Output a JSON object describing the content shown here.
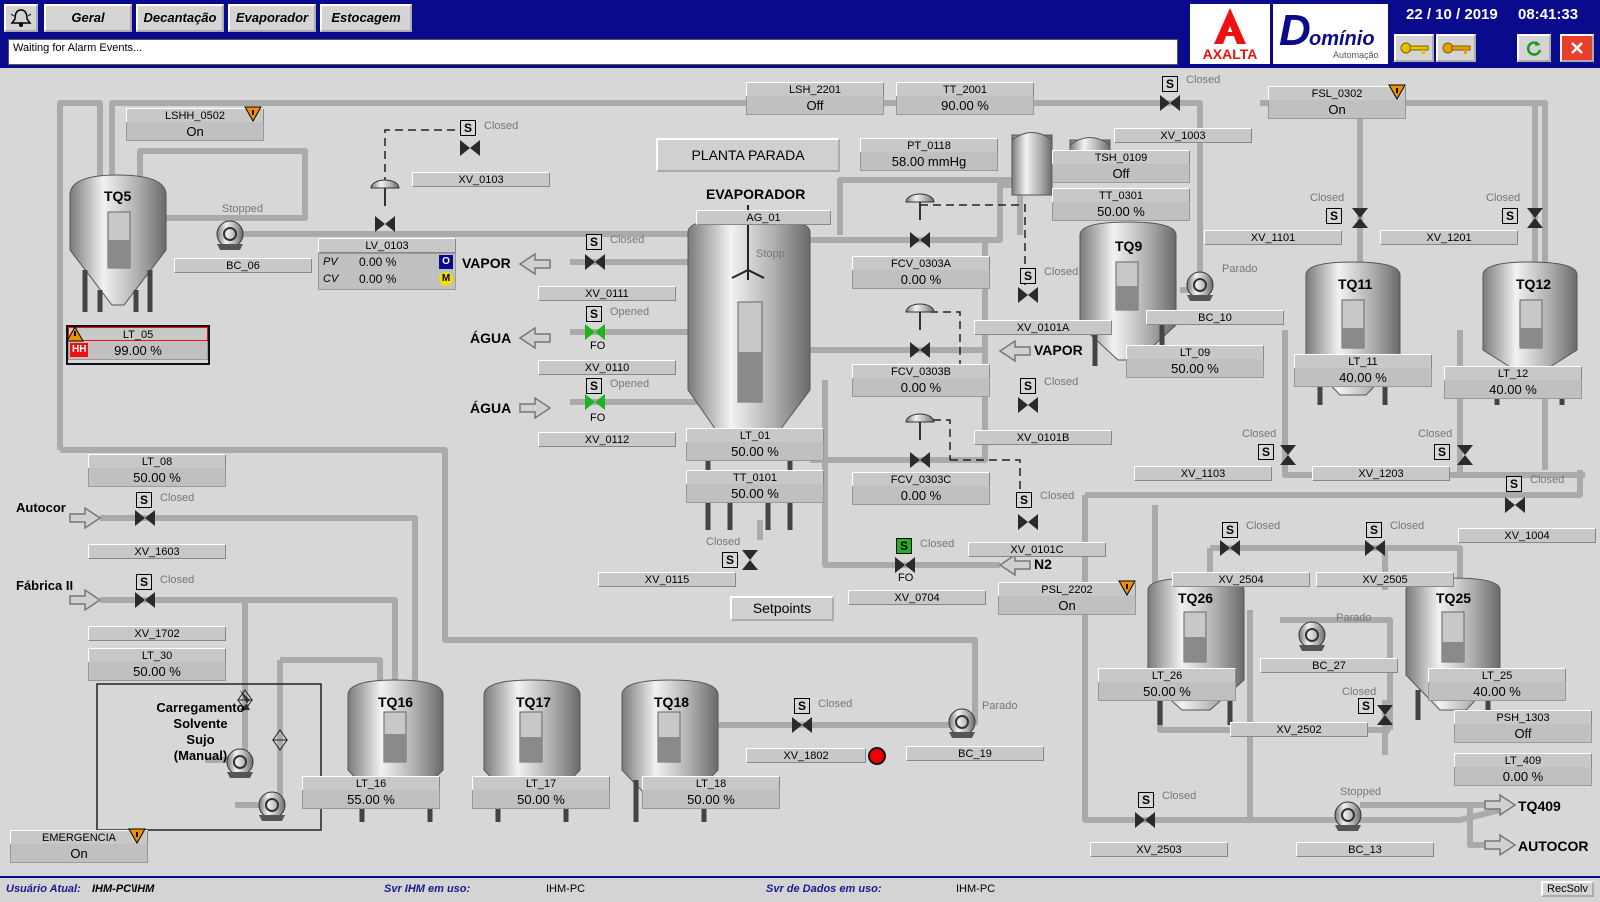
{
  "tabs": [
    "Geral",
    "Decantação",
    "Evaporador",
    "Estocagem"
  ],
  "alarm_text": "Waiting for Alarm Events...",
  "date": "22 / 10 / 2019",
  "time": "08:41:33",
  "logos": {
    "axalta": "AXALTA",
    "dominio": "omínio",
    "dominio_D": "D",
    "dominio_sub": "Automação"
  },
  "status": {
    "user_label": "Usuário Atual:",
    "user_value": "IHM-PC\\IHM",
    "ihm_label": "Svr IHM em uso:",
    "ihm_value": "IHM-PC",
    "dados_label": "Svr de Dados em uso:",
    "dados_value": "IHM-PC",
    "recsolv": "RecSolv"
  },
  "tanks": {
    "tq5": "TQ5",
    "tq9": "TQ9",
    "tq11": "TQ11",
    "tq12": "TQ12",
    "tq26": "TQ26",
    "tq25": "TQ25",
    "tq16": "TQ16",
    "tq17": "TQ17",
    "tq18": "TQ18"
  },
  "tank_levels": {
    "tq5": 0.5,
    "tq9": 0.5,
    "tq11": 0.4,
    "tq12": 0.4,
    "tq26": 0.5,
    "tq25": 0.4,
    "tq16": 0.55,
    "tq17": 0.5,
    "tq18": 0.5,
    "evap": 0.5
  },
  "evaporador": {
    "title": "EVAPORADOR",
    "ag": "AG_01",
    "ag_state": "Stopp"
  },
  "planta": "PLANTA PARADA",
  "setpoints": "Setpoints",
  "carregamento": [
    "Carregamento",
    "Solvente",
    "Sujo",
    "(Manual)"
  ],
  "labels": {
    "vapor1": "VAPOR",
    "agua1": "ÁGUA",
    "agua2": "ÁGUA",
    "vapor2": "VAPOR",
    "n2": "N2",
    "autocor_in": "Autocor",
    "fabrica": "Fábrica II",
    "tq409": "TQ409",
    "autocor_out": "AUTOCOR"
  },
  "tags": {
    "lsh2201": {
      "n": "LSH_2201",
      "v": "Off"
    },
    "tt2001": {
      "n": "TT_2001",
      "v": "90.00 %"
    },
    "lshh0502": {
      "n": "LSHH_0502",
      "v": "On"
    },
    "fsl0302": {
      "n": "FSL_0302",
      "v": "On"
    },
    "pt0118": {
      "n": "PT_0118",
      "v": "58.00 mmHg"
    },
    "tsh0109": {
      "n": "TSH_0109",
      "v": "Off"
    },
    "tt0301": {
      "n": "TT_0301",
      "v": "50.00 %"
    },
    "lt05": {
      "n": "LT_05",
      "v": "99.00 %",
      "alarm": "HH"
    },
    "lt09": {
      "n": "LT_09",
      "v": "50.00 %"
    },
    "lt11": {
      "n": "LT_11",
      "v": "40.00 %"
    },
    "lt12": {
      "n": "LT_12",
      "v": "40.00 %"
    },
    "fcv0303a": {
      "n": "FCV_0303A",
      "v": "0.00 %"
    },
    "fcv0303b": {
      "n": "FCV_0303B",
      "v": "0.00 %"
    },
    "fcv0303c": {
      "n": "FCV_0303C",
      "v": "0.00 %"
    },
    "lt01": {
      "n": "LT_01",
      "v": "50.00 %"
    },
    "tt0101": {
      "n": "TT_0101",
      "v": "50.00 %"
    },
    "lt08": {
      "n": "LT_08",
      "v": "50.00 %"
    },
    "lt30": {
      "n": "LT_30",
      "v": "50.00 %"
    },
    "psl2202": {
      "n": "PSL_2202",
      "v": "On"
    },
    "lt26": {
      "n": "LT_26",
      "v": "50.00 %"
    },
    "lt25": {
      "n": "LT_25",
      "v": "40.00 %"
    },
    "psh1303": {
      "n": "PSH_1303",
      "v": "Off"
    },
    "lt409": {
      "n": "LT_409",
      "v": "0.00 %"
    },
    "lt16": {
      "n": "LT_16",
      "v": "55.00 %"
    },
    "lt17": {
      "n": "LT_17",
      "v": "50.00 %"
    },
    "lt18": {
      "n": "LT_18",
      "v": "50.00 %"
    },
    "emergencia": {
      "n": "EMERGENCIA",
      "v": "On"
    }
  },
  "lv0103": {
    "n": "LV_0103",
    "pv_l": "PV",
    "pv": "0.00 %",
    "cv_l": "CV",
    "cv": "0.00 %",
    "o": "O",
    "m": "M"
  },
  "valve_labels": {
    "xv0103": "XV_0103",
    "xv1003": "XV_1003",
    "xv0111": "XV_0111",
    "xv0110": "XV_0110",
    "xv0112": "XV_0112",
    "xv0101a": "XV_0101A",
    "xv0101b": "XV_0101B",
    "xv0101c": "XV_0101C",
    "xv0115": "XV_0115",
    "xv0704": "XV_0704",
    "xv1101": "XV_1101",
    "xv1201": "XV_1201",
    "xv1103": "XV_1103",
    "xv1203": "XV_1203",
    "xv1004": "XV_1004",
    "xv2504": "XV_2504",
    "xv2505": "XV_2505",
    "xv2502": "XV_2502",
    "xv2503": "XV_2503",
    "xv1603": "XV_1603",
    "xv1702": "XV_1702",
    "xv1802": "XV_1802"
  },
  "pump_labels": {
    "bc06": "BC_06",
    "bc10": "BC_10",
    "bc27": "BC_27",
    "bc13": "BC_13",
    "bc19": "BC_19"
  },
  "states": {
    "closed": "Closed",
    "opened": "Opened",
    "stopped": "Stopped",
    "parado": "Parado",
    "fo": "FO",
    "s": "S"
  }
}
